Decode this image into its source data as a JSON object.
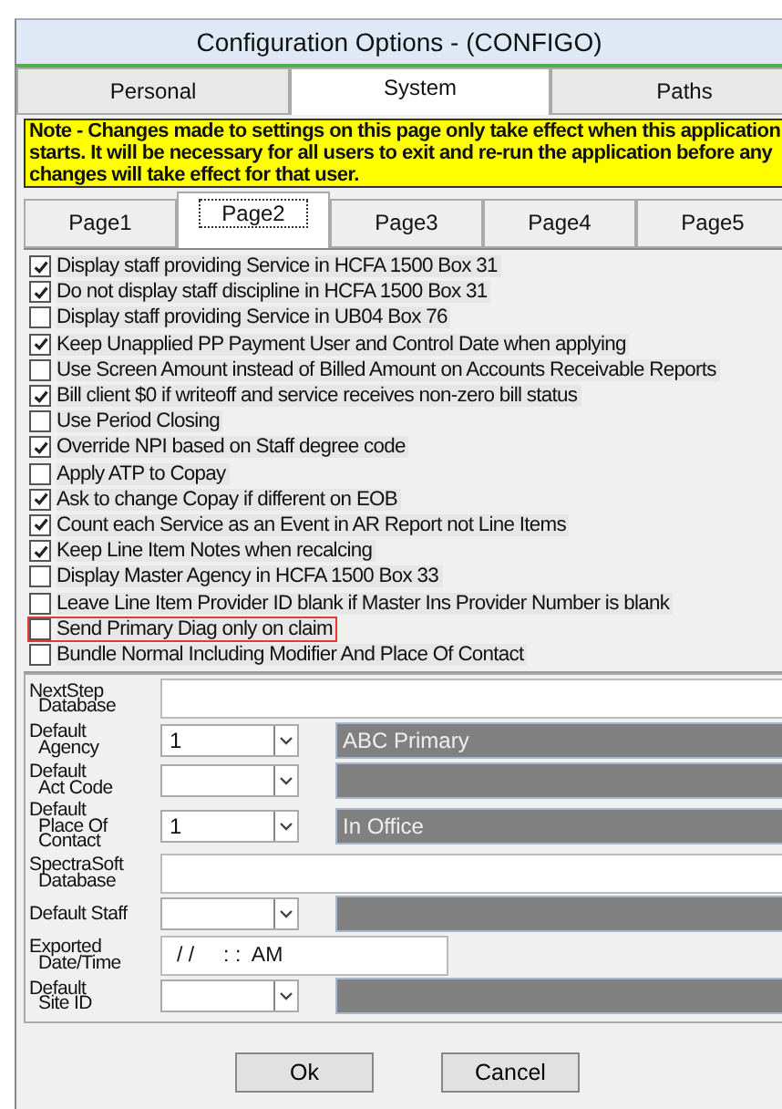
{
  "window": {
    "title": "Configuration Options - (CONFIGO)"
  },
  "tabs": [
    {
      "label": "Personal",
      "selected": false
    },
    {
      "label": "System",
      "selected": true
    },
    {
      "label": "Paths",
      "selected": false
    }
  ],
  "note": "Note - Changes made to settings on this page only take effect when this application starts. It will be necessary for all users to exit and re-run the application before any changes will take effect for that user.",
  "page_tabs": [
    {
      "label": "Page1",
      "selected": false
    },
    {
      "label": "Page2",
      "selected": true
    },
    {
      "label": "Page3",
      "selected": false
    },
    {
      "label": "Page4",
      "selected": false
    },
    {
      "label": "Page5",
      "selected": false
    }
  ],
  "options": [
    {
      "label": "Display staff providing Service in HCFA 1500 Box 31",
      "checked": true,
      "highlighted": false
    },
    {
      "label": "Do not display staff discipline in HCFA 1500 Box 31",
      "checked": true,
      "highlighted": false
    },
    {
      "label": "Display staff providing Service in UB04 Box 76",
      "checked": false,
      "highlighted": false
    },
    {
      "label": "Keep Unapplied PP Payment User and Control Date when applying",
      "checked": true,
      "highlighted": false
    },
    {
      "label": "Use Screen Amount instead of Billed Amount on Accounts Receivable Reports",
      "checked": false,
      "highlighted": false
    },
    {
      "label": "Bill client $0 if writeoff and service receives non-zero bill status",
      "checked": true,
      "highlighted": false
    },
    {
      "label": "Use Period Closing",
      "checked": false,
      "highlighted": false
    },
    {
      "label": "Override NPI based on Staff degree code",
      "checked": true,
      "highlighted": false
    },
    {
      "label": "Apply ATP to Copay",
      "checked": false,
      "highlighted": false
    },
    {
      "label": "Ask to change Copay if different on EOB",
      "checked": true,
      "highlighted": false
    },
    {
      "label": "Count each Service as an Event in AR Report not Line Items",
      "checked": true,
      "highlighted": false
    },
    {
      "label": "Keep Line Item Notes when recalcing",
      "checked": true,
      "highlighted": false
    },
    {
      "label": "Display Master Agency in HCFA 1500 Box 33",
      "checked": false,
      "highlighted": false
    },
    {
      "label": "Leave Line Item Provider ID blank if Master Ins Provider Number is blank",
      "checked": false,
      "highlighted": false
    },
    {
      "label": "Send Primary Diag only on claim",
      "checked": false,
      "highlighted": true
    },
    {
      "label": "Bundle Normal Including Modifier And Place Of Contact",
      "checked": false,
      "highlighted": false
    }
  ],
  "fields": [
    {
      "kind": "text",
      "label": [
        "NextStep",
        "Database"
      ]
    },
    {
      "kind": "combo",
      "label": [
        "Default",
        "Agency"
      ],
      "value": "1",
      "description": "ABC Primary"
    },
    {
      "kind": "combo",
      "label": [
        "Default",
        "Act Code"
      ]
    },
    {
      "kind": "combo",
      "label": [
        "Default",
        "Place Of",
        "Contact"
      ],
      "value": "1",
      "description": "In Office"
    },
    {
      "kind": "text",
      "label": [
        "SpectraSoft",
        "Database"
      ]
    },
    {
      "kind": "combo",
      "label": [
        "Default Staff"
      ]
    },
    {
      "kind": "short",
      "label": [
        "Exported",
        "Date/Time"
      ],
      "value": "/ /     : :  AM"
    },
    {
      "kind": "combo",
      "label": [
        "Default",
        "Site ID"
      ]
    }
  ],
  "buttons": [
    "Ok",
    "Cancel"
  ]
}
